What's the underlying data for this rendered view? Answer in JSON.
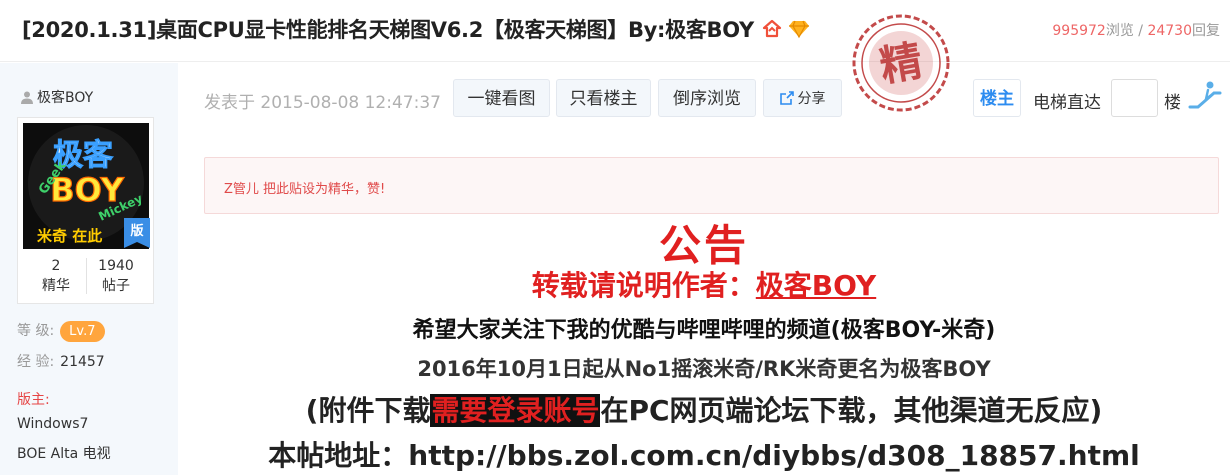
{
  "header": {
    "title": "[2020.1.31]桌面CPU显卡性能排名天梯图V6.2【极客天梯图】By:极客BOY",
    "views": "995972",
    "views_label": "浏览",
    "separator": "/",
    "replies": "24730",
    "replies_label": "回复",
    "icons": [
      "hot-house-icon",
      "gem-icon"
    ]
  },
  "stamp": {
    "text": "精",
    "color": "#b92b2b"
  },
  "user": {
    "name": "极客BOY",
    "avatar_text": [
      "极客",
      "BOY",
      "Geek",
      "Mickey",
      "米奇 在此"
    ],
    "avatar_badge": "版",
    "jinghua_count": "2",
    "jinghua_label": "精华",
    "posts_count": "1940",
    "posts_label": "帖子",
    "level_label": "等  级:",
    "level_value": "Lv.7",
    "exp_label": "经  验:",
    "exp_value": "21457",
    "moderator_label": "版主:",
    "moderated_boards": [
      "Windows7",
      "BOE Alta 电视",
      "…"
    ]
  },
  "toolbar": {
    "post_time": "发表于 2015-08-08 12:47:37",
    "btn_view_all_images": "一键看图",
    "btn_only_op": "只看楼主",
    "btn_reverse": "倒序浏览",
    "btn_share": "分享",
    "btn_louzhu": "楼主",
    "elevator_label": "电梯直达",
    "floor_input_value": "",
    "floor_suffix": "楼"
  },
  "notice": {
    "text": "Z管儿 把此贴设为精华，赞!"
  },
  "content": {
    "line1": "公告",
    "line2_prefix": "转载请说明作者：",
    "line2_author": "极客BOY",
    "line3": "希望大家关注下我的优酷与哔哩哔哩的频道(极客BOY-米奇)",
    "line4": "2016年10月1日起从No1摇滚米奇/RK米奇更名为极客BOY",
    "line5_prefix": "(附件下载",
    "line5_highlight": "需要登录账号",
    "line5_suffix": "在PC网页端论坛下载，其他渠道无反应)",
    "line6": "本帖地址：http://bbs.zol.com.cn/diybbs/d308_18857.html"
  },
  "colors": {
    "accent_blue": "#2d8cf0",
    "alert_red": "#e02020",
    "level_orange": "#ffa53d",
    "sidebar_bg": "#f4f8fc"
  }
}
